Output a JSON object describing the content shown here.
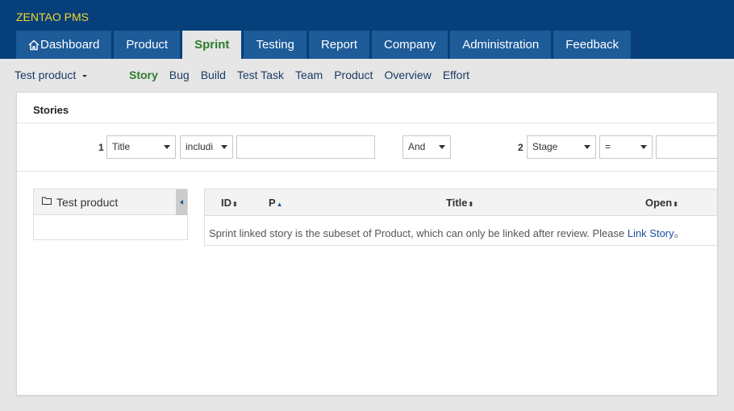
{
  "brand": "ZENTAO PMS",
  "main_nav": [
    {
      "label": "Dashboard",
      "icon": "home-icon"
    },
    {
      "label": "Product"
    },
    {
      "label": "Sprint",
      "active": true
    },
    {
      "label": "Testing"
    },
    {
      "label": "Report"
    },
    {
      "label": "Company"
    },
    {
      "label": "Administration"
    },
    {
      "label": "Feedback"
    }
  ],
  "product_switcher": "Test product",
  "sub_nav": [
    "Story",
    "Bug",
    "Build",
    "Test Task",
    "Team",
    "Product",
    "Overview",
    "Effort"
  ],
  "sub_nav_active": "Story",
  "panel_title": "Stories",
  "search": {
    "group1": {
      "number": "1",
      "field": "Title",
      "operator": "includi",
      "value": ""
    },
    "logic": "And",
    "group2": {
      "number": "2",
      "field": "Stage",
      "operator": "=",
      "value": ""
    }
  },
  "tree": {
    "root": "Test product"
  },
  "grid": {
    "columns": [
      "ID",
      "P",
      "Title",
      "Open"
    ],
    "empty_message": "Sprint linked story is the subeset of Product, which can only be linked after review. Please ",
    "empty_link": "Link Story",
    "empty_suffix": "。"
  },
  "colors": {
    "topbar": "#063f7a",
    "tab": "#1d5b99",
    "brand": "#f2d72a",
    "active": "#2c7d2c"
  }
}
